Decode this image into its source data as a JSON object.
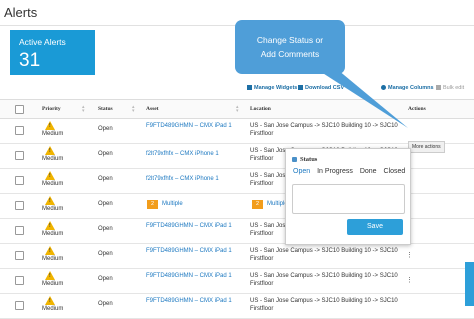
{
  "page": {
    "title": "Alerts"
  },
  "summary_card": {
    "label": "Active Alerts",
    "count": "31",
    "color": "#1a9ad6"
  },
  "toolbar": {
    "manage_widgets": "Manage Widgets",
    "download_csv": "Download CSV",
    "manage_columns": "Manage Columns",
    "bulk_edit": "Bulk edit"
  },
  "table": {
    "headers": {
      "priority": "Priority",
      "status": "Status",
      "asset": "Asset",
      "location": "Location",
      "actions": "Actions"
    },
    "rows": [
      {
        "priority": "Medium",
        "status": "Open",
        "asset": "F9FTD489GHMN – CMX iPad 1",
        "location": "US - San Jose Campus -> SJC10 Building 10 -> SJC10 Firstfloor",
        "badge": ""
      },
      {
        "priority": "Medium",
        "status": "Open",
        "asset": "f2lt79xfhfx – CMX iPhone 1",
        "location": "US - San Jose Campus -> SJC10 Building 10 -> SJC10 Firstfloor",
        "badge": ""
      },
      {
        "priority": "Medium",
        "status": "Open",
        "asset": "f2lt79xfhfx – CMX iPhone 1",
        "location": "US - San Jose Campus -> SJC10 Building 10 -> SJC10 Firstfloor",
        "badge": ""
      },
      {
        "priority": "Medium",
        "status": "Open",
        "asset": "Multiple",
        "location": "Multiple",
        "badge": "2"
      },
      {
        "priority": "Medium",
        "status": "Open",
        "asset": "F9FTD489GHMN – CMX iPad 1",
        "location": "US - San Jose Campus -> SJC10 Building 10 -> SJC10 Firstfloor",
        "badge": ""
      },
      {
        "priority": "Medium",
        "status": "Open",
        "asset": "F9FTD489GHMN – CMX iPad 1",
        "location": "US - San Jose Campus -> SJC10 Building 10 -> SJC10 Firstfloor",
        "badge": ""
      },
      {
        "priority": "Medium",
        "status": "Open",
        "asset": "F9FTD489GHMN – CMX iPad 1",
        "location": "US - San Jose Campus -> SJC10 Building 10 -> SJC10 Firstfloor",
        "badge": ""
      },
      {
        "priority": "Medium",
        "status": "Open",
        "asset": "F9FTD489GHMN – CMX iPad 1",
        "location": "US - San Jose Campus -> SJC10 Building 10 -> SJC10 Firstfloor",
        "badge": ""
      }
    ]
  },
  "callout": {
    "line1": "Change Status or",
    "line2": "Add Comments"
  },
  "more_actions": "More actions",
  "status_popover": {
    "title": "Status",
    "options": [
      "Open",
      "In Progress",
      "Done",
      "Closed"
    ],
    "selected": "Open",
    "save_label": "Save"
  },
  "colors": {
    "accent": "#2d9fd9",
    "link": "#1c78c0",
    "warning": "#f0b400",
    "badge": "#f29d1c",
    "callout": "#4f9ed8"
  }
}
